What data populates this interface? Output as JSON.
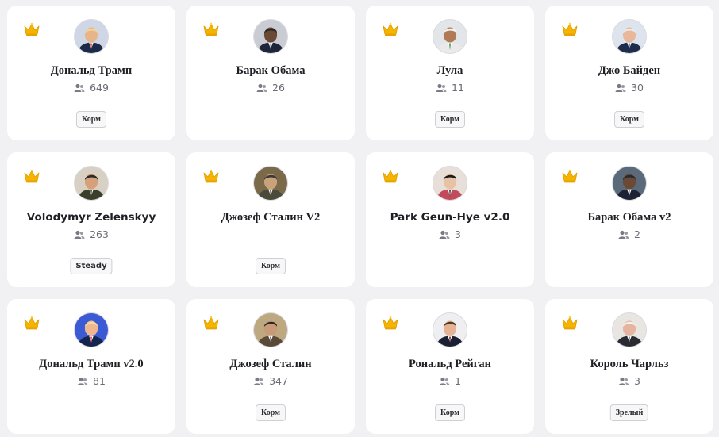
{
  "colors": {
    "crown": "#f5b400",
    "background": "#f1f1f3",
    "card": "#ffffff"
  },
  "cards": [
    {
      "name": "Дональд Трамп",
      "count": "649",
      "tag": "Корм",
      "avatar": "trump-avatar"
    },
    {
      "name": "Барак Обама",
      "count": "26",
      "tag": "",
      "avatar": "obama-avatar"
    },
    {
      "name": "Лула",
      "count": "11",
      "tag": "Корм",
      "avatar": "lula-avatar"
    },
    {
      "name": "Джо Байден",
      "count": "30",
      "tag": "Корм",
      "avatar": "biden-avatar"
    },
    {
      "name": "Volodymyr Zelenskyy",
      "count": "263",
      "tag": "Steady",
      "avatar": "zelenskyy-avatar"
    },
    {
      "name": "Джозеф Сталин V2",
      "count": "",
      "tag": "Корм",
      "avatar": "stalin-avatar"
    },
    {
      "name": "Park Geun-Hye v2.0",
      "count": "3",
      "tag": "",
      "avatar": "park-avatar"
    },
    {
      "name": "Барак Обама v2",
      "count": "2",
      "tag": "",
      "avatar": "obama-v2-avatar"
    },
    {
      "name": "Дональд Трамп v2.0",
      "count": "81",
      "tag": "",
      "avatar": "trump-v2-avatar"
    },
    {
      "name": "Джозеф Сталин",
      "count": "347",
      "tag": "Корм",
      "avatar": "stalin-v1-avatar"
    },
    {
      "name": "Рональд Рейган",
      "count": "1",
      "tag": "Корм",
      "avatar": "reagan-avatar"
    },
    {
      "name": "Король Чарльз",
      "count": "3",
      "tag": "Зрелый",
      "avatar": "charles-avatar"
    }
  ]
}
